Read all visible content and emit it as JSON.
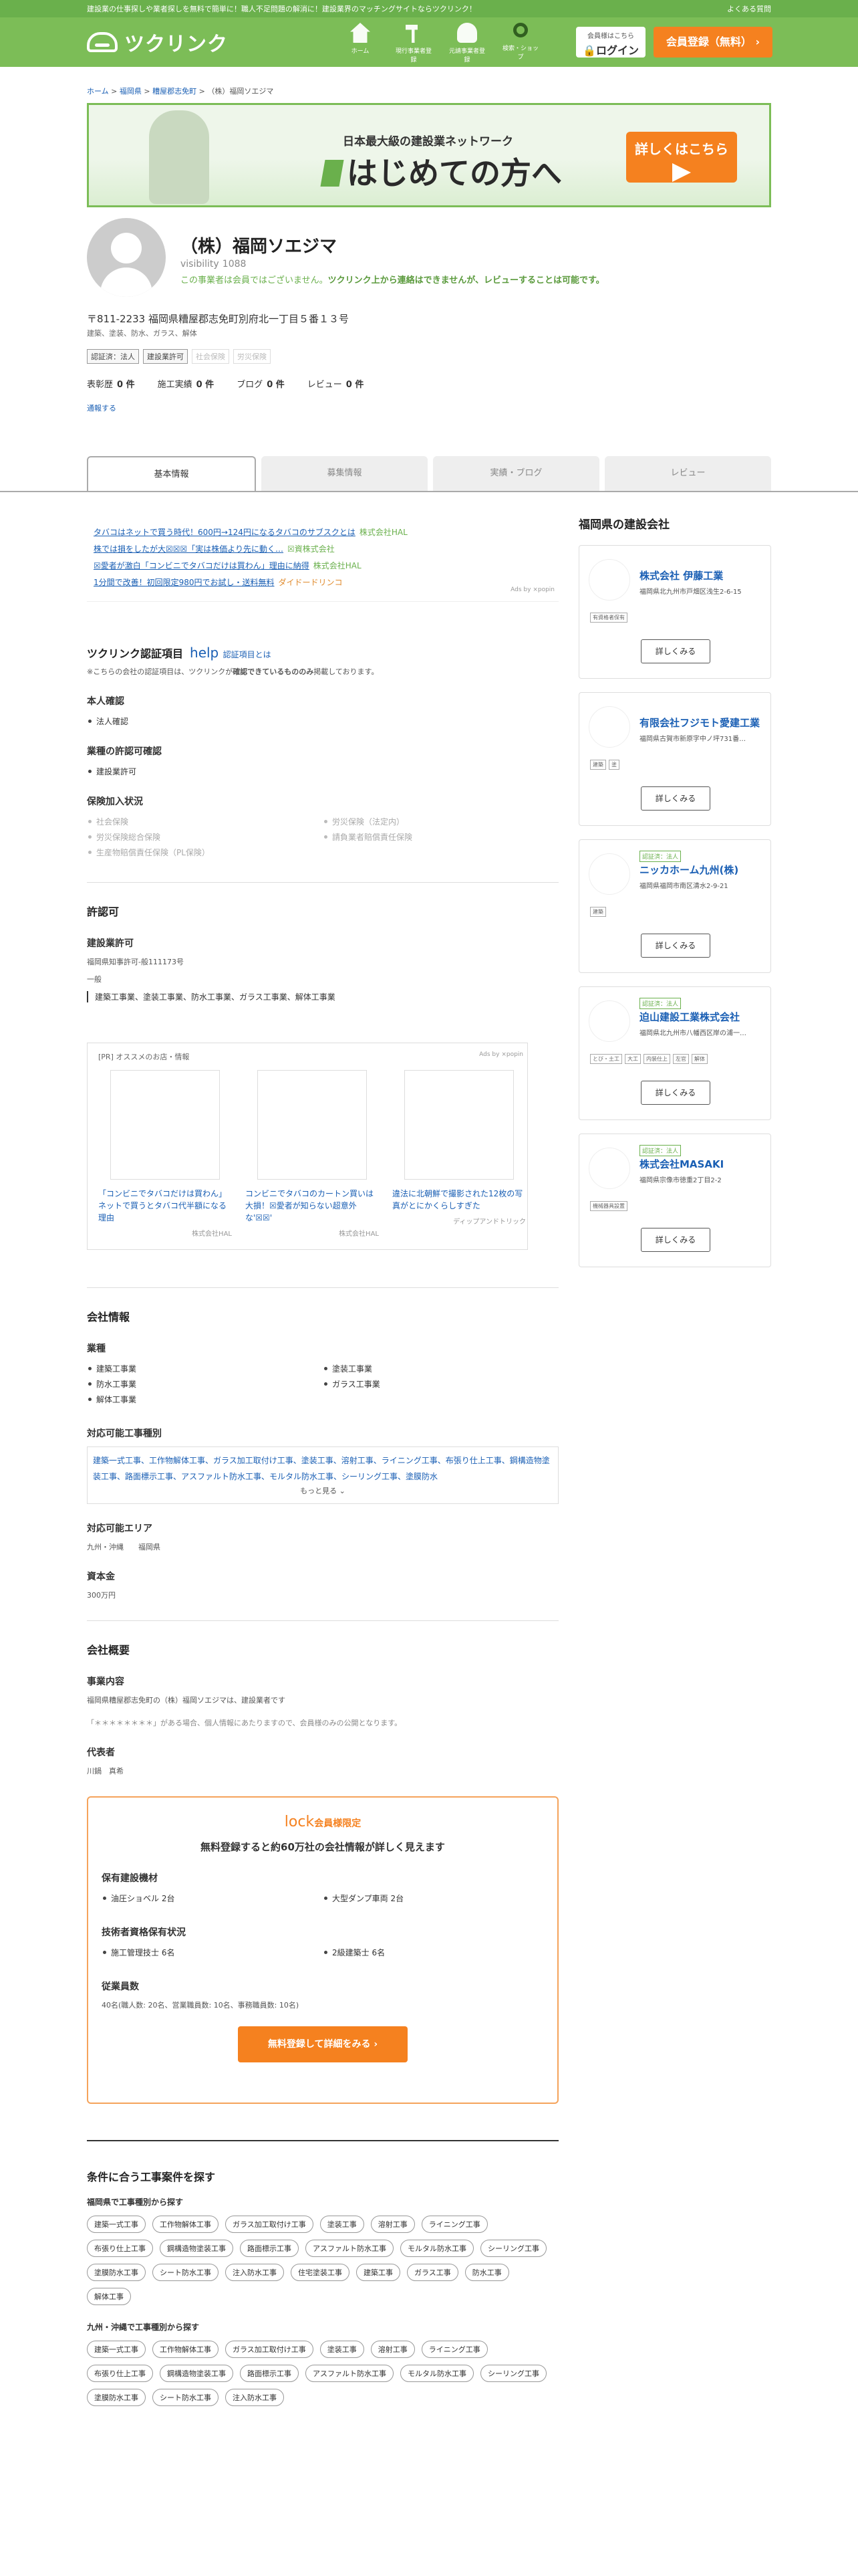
{
  "topbar": {
    "text": "建設業の仕事探しや業者探しを無料で簡単に！職人不足問題の解消に！建設業界のマッチングサイトならツクリンク！",
    "faq": "よくある質問"
  },
  "header": {
    "logo": "ツクリンク",
    "nav": [
      "ホーム",
      "現行事業者登録",
      "元請事業者登録",
      "検索・ショップ"
    ],
    "login_caption": "会員様はこちら",
    "login_label": "ログイン",
    "signup_label": "会員登録（無料）"
  },
  "breadcrumb": [
    "ホーム",
    "福岡県",
    "糟屋郡志免町",
    "（株）福岡ソエジマ"
  ],
  "banner": {
    "sub": "日本最大級の建設業ネットワーク",
    "main": "はじめての方へ",
    "cta": "詳しくはこちら"
  },
  "profile": {
    "name": "（株）福岡ソエジマ",
    "visibility_icon": "visibility",
    "visibility_count": "1088",
    "notice_a": "この事業者は会員ではございません。",
    "notice_b": "ツクリンク上から連絡はできませんが、レビューすることは可能です。",
    "address": "〒811-2233 福岡県糟屋郡志免町別府北一丁目５番１３号",
    "trades": "建築、塗装、防水、ガラス、解体",
    "badges": [
      {
        "label": "認証済：法人",
        "on": true
      },
      {
        "label": "建設業許可",
        "on": true
      },
      {
        "label": "社会保険",
        "on": false
      },
      {
        "label": "労災保険",
        "on": false
      }
    ],
    "stats": [
      {
        "label": "表彰歴",
        "value": "0 件"
      },
      {
        "label": "施工実績",
        "value": "0 件"
      },
      {
        "label": "ブログ",
        "value": "0 件"
      },
      {
        "label": "レビュー",
        "value": "0 件"
      }
    ],
    "report": "通報する"
  },
  "tabs": [
    "基本情報",
    "募集情報",
    "実績・ブログ",
    "レビュー"
  ],
  "ads": [
    {
      "text": "タバコはネットで買う時代！600円→124円になるタバコのサブスクとは",
      "src": "株式会社HAL"
    },
    {
      "text": "株では損をしたが大☒☒☒「実は株価より先に動く…",
      "src": "☒資株式会社"
    },
    {
      "text": "☒愛者が激白「コンビニでタバコだけは買わん」理由に納得",
      "src": "株式会社HAL"
    },
    {
      "text": "1分間で改善！初回限定980円でお試し・送料無料",
      "src": "ダイドードリンコ"
    }
  ],
  "ads_by": "Ads by ⨯popin",
  "cert": {
    "title": "ツクリンク認証項目",
    "help": "help",
    "help_text": "認証項目とは",
    "note_a": "※こちらの会社の認証項目は、ツクリンクが",
    "note_b": "確認できているもののみ",
    "note_c": "掲載しております。",
    "identity_h": "本人確認",
    "identity": [
      "法人確認"
    ],
    "license_h": "業種の許認可確認",
    "license": [
      "建設業許可"
    ],
    "insurance_h": "保険加入状況",
    "insurance": [
      "社会保険",
      "労災保険（法定内）",
      "労災保険総合保険",
      "請負業者賠償責任保険",
      "生産物賠償責任保険（PL保険）"
    ]
  },
  "permit": {
    "title": "許認可",
    "sub": "建設業許可",
    "number": "福岡県知事許可-般111173号",
    "kind": "一般",
    "list": "建築工事業、塗装工事業、防水工事業、ガラス工事業、解体工事業"
  },
  "pr": {
    "title": "[PR] オススメのお店・情報",
    "ads_by": "Ads by ⨯popin",
    "items": [
      {
        "caption": "「コンビニでタバコだけは買わん」ネットで買うとタバコ代半額になる理由",
        "by": "株式会社HAL"
      },
      {
        "caption": "コンビニでタバコのカートン買いは大損！☒愛者が知らない超意外な'☒☒'",
        "by": "株式会社HAL"
      },
      {
        "caption": "違法に北朝鮮で撮影された12枚の写真がとにかくらしすぎた",
        "by": "ディップアンドトリック"
      }
    ]
  },
  "company": {
    "title": "会社情報",
    "industries_h": "業種",
    "industries": [
      "建築工事業",
      "塗装工事業",
      "防水工事業",
      "ガラス工事業",
      "解体工事業"
    ],
    "works_h": "対応可能工事種別",
    "works": "建築一式工事、工作物解体工事、ガラス加工取付け工事、塗装工事、溶射工事、ライニング工事、布張り仕上工事、鋼構造物塗装工事、路面標示工事、アスファルト防水工事、モルタル防水工事、シーリング工事、塗膜防水",
    "more": "もっと見る",
    "area_h": "対応可能エリア",
    "area": "九州・沖縄　　福岡県",
    "capital_h": "資本金",
    "capital": "300万円"
  },
  "overview": {
    "title": "会社概要",
    "biz_h": "事業内容",
    "biz": "福岡県糟屋郡志免町の（株）福岡ソエジマは、建設業者です",
    "privacy": "「＊＊＊＊＊＊＊＊」がある場合、個人情報にあたりますので、会員様のみの公開となります。",
    "rep_h": "代表者",
    "rep": "川鍋　真希"
  },
  "member": {
    "icon": "lock",
    "title": "会員様限定",
    "lead": "無料登録すると約60万社の会社情報が詳しく見えます",
    "eq_h": "保有建設機材",
    "eq": [
      "油圧ショベル 2台",
      "大型ダンプ車両 2台"
    ],
    "lic_h": "技術者資格保有状況",
    "lic": [
      "施工管理技士 6名",
      "2級建築士 6名"
    ],
    "emp_h": "従業員数",
    "emp": "40名(職人数: 20名、営業職員数: 10名、事務職員数: 10名)",
    "cta": "無料登録して詳細をみる"
  },
  "search": {
    "title": "条件に合う工事案件を探す",
    "a_h": "福岡県で工事種別から探す",
    "a": [
      "建築一式工事",
      "工作物解体工事",
      "ガラス加工取付け工事",
      "塗装工事",
      "溶射工事",
      "ライニング工事",
      "布張り仕上工事",
      "鋼構造物塗装工事",
      "路面標示工事",
      "アスファルト防水工事",
      "モルタル防水工事",
      "シーリング工事",
      "塗膜防水工事",
      "シート防水工事",
      "注入防水工事",
      "住宅塗装工事",
      "建築工事",
      "ガラス工事",
      "防水工事",
      "解体工事"
    ],
    "b_h": "九州・沖縄で工事種別から探す",
    "b": [
      "建築一式工事",
      "工作物解体工事",
      "ガラス加工取付け工事",
      "塗装工事",
      "溶射工事",
      "ライニング工事",
      "布張り仕上工事",
      "鋼構造物塗装工事",
      "路面標示工事",
      "アスファルト防水工事",
      "モルタル防水工事",
      "シーリング工事",
      "塗膜防水工事",
      "シート防水工事",
      "注入防水工事"
    ]
  },
  "side": {
    "title": "福岡県の建設会社",
    "detail": "詳しくみる",
    "cards": [
      {
        "cert": "",
        "name": "株式会社 伊藤工業",
        "addr": "福岡県北九州市戸畑区浅生2-6-15",
        "tags": [
          "有資格者保有"
        ]
      },
      {
        "cert": "",
        "name": "有限会社フジモト愛建工業",
        "addr": "福岡県古賀市新原字中ノ坪731番…",
        "tags": [
          "建築",
          "塗"
        ]
      },
      {
        "cert": "認証済：法人",
        "name": "ニッカホーム九州(株)",
        "addr": "福岡県福岡市南区清水2-9-21",
        "tags": [
          "建築"
        ]
      },
      {
        "cert": "認証済：法人",
        "name": "迫山建設工業株式会社",
        "addr": "福岡県北九州市八幡西区岸の浦一…",
        "tags": [
          "とび・土工",
          "大工",
          "内装仕上",
          "左官",
          "解体"
        ]
      },
      {
        "cert": "認証済：法人",
        "name": "株式会社MASAKI",
        "addr": "福岡県宗像市徳重2丁目2-2",
        "tags": [
          "機械器具設置"
        ]
      }
    ]
  }
}
